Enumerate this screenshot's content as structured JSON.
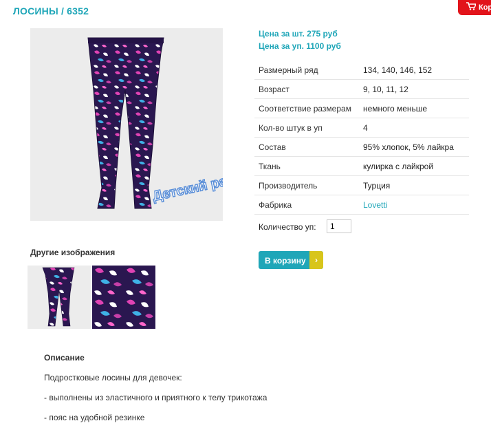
{
  "header": {
    "title": "ЛОСИНЫ / 6352",
    "cart_label": "Кор"
  },
  "product": {
    "main_image_icon": "leggings-photo",
    "watermark": "Детский размер",
    "price_item": "Цена за шт. 275 руб",
    "price_pack": "Цена за уп. 1100 руб",
    "specs": [
      {
        "key": "Размерный ряд",
        "value": "134, 140, 146, 152"
      },
      {
        "key": "Возраст",
        "value": "9, 10, 11, 12"
      },
      {
        "key": "Соответствие размерам",
        "value": "немного меньше"
      },
      {
        "key": "Кол-во штук в уп",
        "value": "4"
      },
      {
        "key": "Состав",
        "value": "95% хлопок, 5% лайкра"
      },
      {
        "key": "Ткань",
        "value": "кулирка с лайкрой"
      },
      {
        "key": "Производитель",
        "value": "Турция"
      },
      {
        "key": "Фабрика",
        "value": "Lovetti"
      }
    ],
    "quantity_label": "Количество уп:",
    "quantity_value": "1",
    "add_to_cart": "В корзину",
    "add_to_cart_arrow": "›"
  },
  "gallery": {
    "heading": "Другие изображения"
  },
  "description": {
    "heading": "Описание",
    "lines": [
      "Подростковые лосины для девочек:",
      "- выполнены из эластичного и приятного к телу трикотажа",
      "- пояс на удобной резинке"
    ]
  },
  "colors": {
    "accent": "#1fa6b8",
    "cart_tab": "#e2141b",
    "button_arrow": "#d8c51b",
    "fabric": "#2a1750"
  }
}
